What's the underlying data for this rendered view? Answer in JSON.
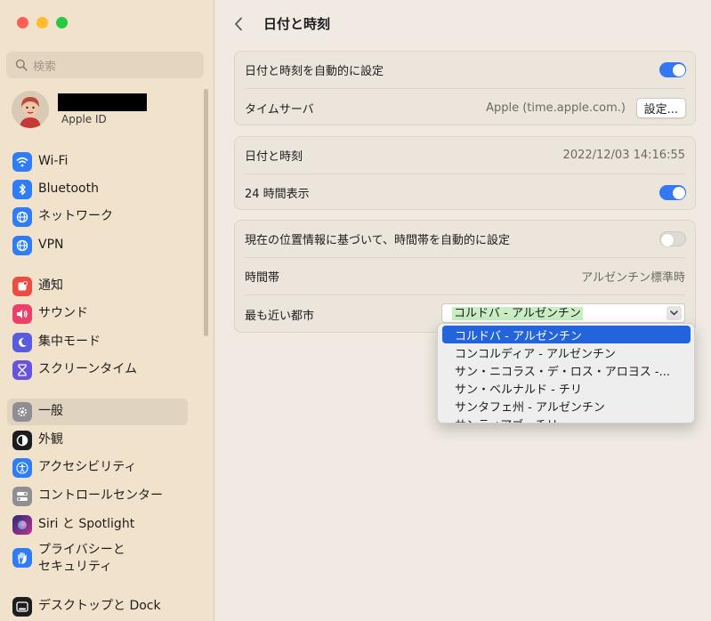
{
  "sidebar": {
    "search_placeholder": "検索",
    "account_subtitle": "Apple ID",
    "items": [
      {
        "label": "Wi-Fi",
        "icon": "wifi-icon",
        "color": "#2f7df6"
      },
      {
        "label": "Bluetooth",
        "icon": "bluetooth-icon",
        "color": "#2f7df6"
      },
      {
        "label": "ネットワーク",
        "icon": "globe-icon",
        "color": "#2f7df6"
      },
      {
        "label": "VPN",
        "icon": "vpn-globe-icon",
        "color": "#2f7df6"
      },
      {
        "label": "通知",
        "icon": "bell-icon",
        "color": "#ee4b43"
      },
      {
        "label": "サウンド",
        "icon": "speaker-icon",
        "color": "#ee3f6b"
      },
      {
        "label": "集中モード",
        "icon": "moon-icon",
        "color": "#5a5ce0"
      },
      {
        "label": "スクリーンタイム",
        "icon": "hourglass-icon",
        "color": "#6654e0"
      },
      {
        "label": "一般",
        "icon": "gear-icon",
        "color": "#8e8e93"
      },
      {
        "label": "外観",
        "icon": "appearance-icon",
        "color": "#1d1d1f"
      },
      {
        "label": "アクセシビリティ",
        "icon": "accessibility-icon",
        "color": "#2f7df6"
      },
      {
        "label": "コントロールセンター",
        "icon": "control-center-icon",
        "color": "#8e8e93"
      },
      {
        "label": "Siri と Spotlight",
        "icon": "siri-icon",
        "color": "#7a3fd9"
      },
      {
        "label": "プライバシーと\nセキュリティ",
        "icon": "hand-icon",
        "color": "#2f7df6"
      },
      {
        "label": "デスクトップと Dock",
        "icon": "dock-icon",
        "color": "#1d1d1f"
      }
    ],
    "selected_index": 8
  },
  "header": {
    "title": "日付と時刻"
  },
  "group1": {
    "auto_label": "日付と時刻を自動的に設定",
    "auto_on": true,
    "server_label": "タイムサーバ",
    "server_value": "Apple (time.apple.com.)",
    "server_button": "設定..."
  },
  "group2": {
    "datetime_label": "日付と時刻",
    "datetime_value": "2022/12/03 14:16:55",
    "h24_label": "24 時間表示",
    "h24_on": true
  },
  "group3": {
    "auto_tz_label": "現在の位置情報に基づいて、時間帯を自動的に設定",
    "auto_tz_on": false,
    "tz_label": "時間帯",
    "tz_value": "アルゼンチン標準時",
    "city_label": "最も近い都市",
    "city_value": "コルドバ - アルゼンチン"
  },
  "dropdown": {
    "items": [
      "コルドバ - アルゼンチン",
      "コンコルディア - アルゼンチン",
      "サン・ニコラス・デ・ロス・アロヨス -...",
      "サン・ベルナルド - チリ",
      "サンタフェ州 - アルゼンチン",
      "サンティアゴ - チリ"
    ],
    "selected_index": 0
  },
  "colors": {
    "accent": "#3478f6",
    "selection": "#2364dc",
    "traffic_red": "#ff5f57",
    "traffic_yellow": "#febc2e",
    "traffic_green": "#28c840"
  }
}
